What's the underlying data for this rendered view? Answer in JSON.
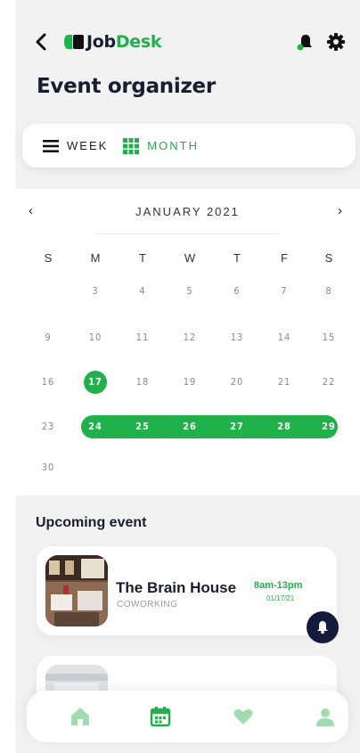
{
  "app": {
    "brand_prefix": "Job",
    "brand_suffix": "Desk"
  },
  "header": {
    "title": "Event organizer"
  },
  "view_toggle": {
    "week_label": "WEEK",
    "month_label": "MONTH",
    "active": "month"
  },
  "calendar": {
    "month_label": "JANUARY 2021",
    "weekdays": [
      "S",
      "M",
      "T",
      "W",
      "T",
      "F",
      "S"
    ],
    "weeks": [
      [
        "",
        "3",
        "4",
        "5",
        "6",
        "7",
        "8"
      ],
      [
        "9",
        "10",
        "11",
        "12",
        "13",
        "14",
        "15"
      ],
      [
        "16",
        "17",
        "18",
        "19",
        "20",
        "21",
        "22"
      ],
      [
        "23",
        "24",
        "25",
        "26",
        "27",
        "28",
        "29"
      ],
      [
        "30",
        "",
        "",
        "",
        "",
        "",
        ""
      ]
    ],
    "today": "17",
    "selected_range": [
      "24",
      "25",
      "26",
      "27",
      "28",
      "29"
    ]
  },
  "upcoming": {
    "title": "Upcoming event",
    "events": [
      {
        "name": "The Brain House",
        "type": "COWORKING",
        "time": "8am-13pm",
        "date": "01/17/21"
      }
    ]
  },
  "colors": {
    "accent": "#1fb14a",
    "dark": "#141b3a",
    "nav_icon": "#9fdcb0"
  },
  "icons": [
    "back-arrow-icon",
    "notification-bell-icon",
    "settings-gear-icon",
    "list-view-icon",
    "grid-view-icon",
    "chevron-left-icon",
    "chevron-right-icon",
    "home-icon",
    "calendar-icon",
    "heart-icon",
    "profile-icon"
  ]
}
